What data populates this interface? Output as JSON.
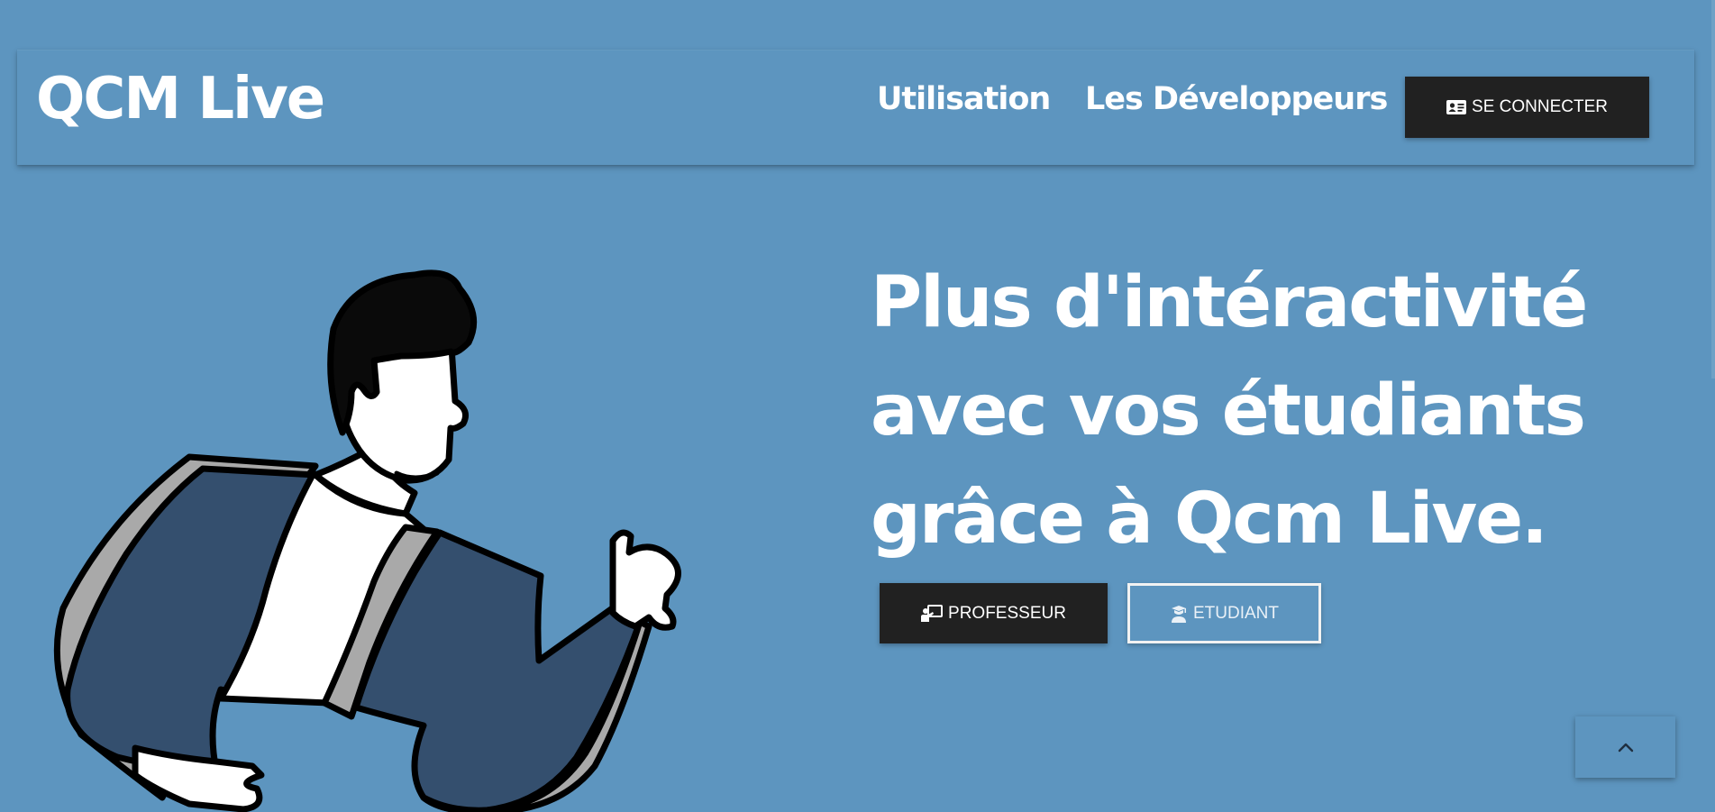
{
  "navbar": {
    "brand": "QCM Live",
    "links": [
      {
        "label": "Utilisation"
      },
      {
        "label": "Les Développeurs"
      }
    ],
    "connect_label": "SE CONNECTER",
    "connect_icon": "id-card-icon"
  },
  "hero": {
    "title": "Plus d'intéractivité avec vos étudiants grâce à Qcm Live.",
    "buttons": {
      "professor_label": "PROFESSEUR",
      "professor_icon": "chalkboard-teacher-icon",
      "student_label": "ETUDIANT",
      "student_icon": "graduate-icon"
    },
    "illustration": "man-checking-watch"
  },
  "scroll_top_icon": "chevron-up-icon",
  "colors": {
    "background": "#5d95bf",
    "button_dark": "#212121",
    "text": "#ffffff",
    "jacket": "#344f6e",
    "jacket_shadow": "#a9a9a9",
    "hair": "#0a0a0a"
  }
}
